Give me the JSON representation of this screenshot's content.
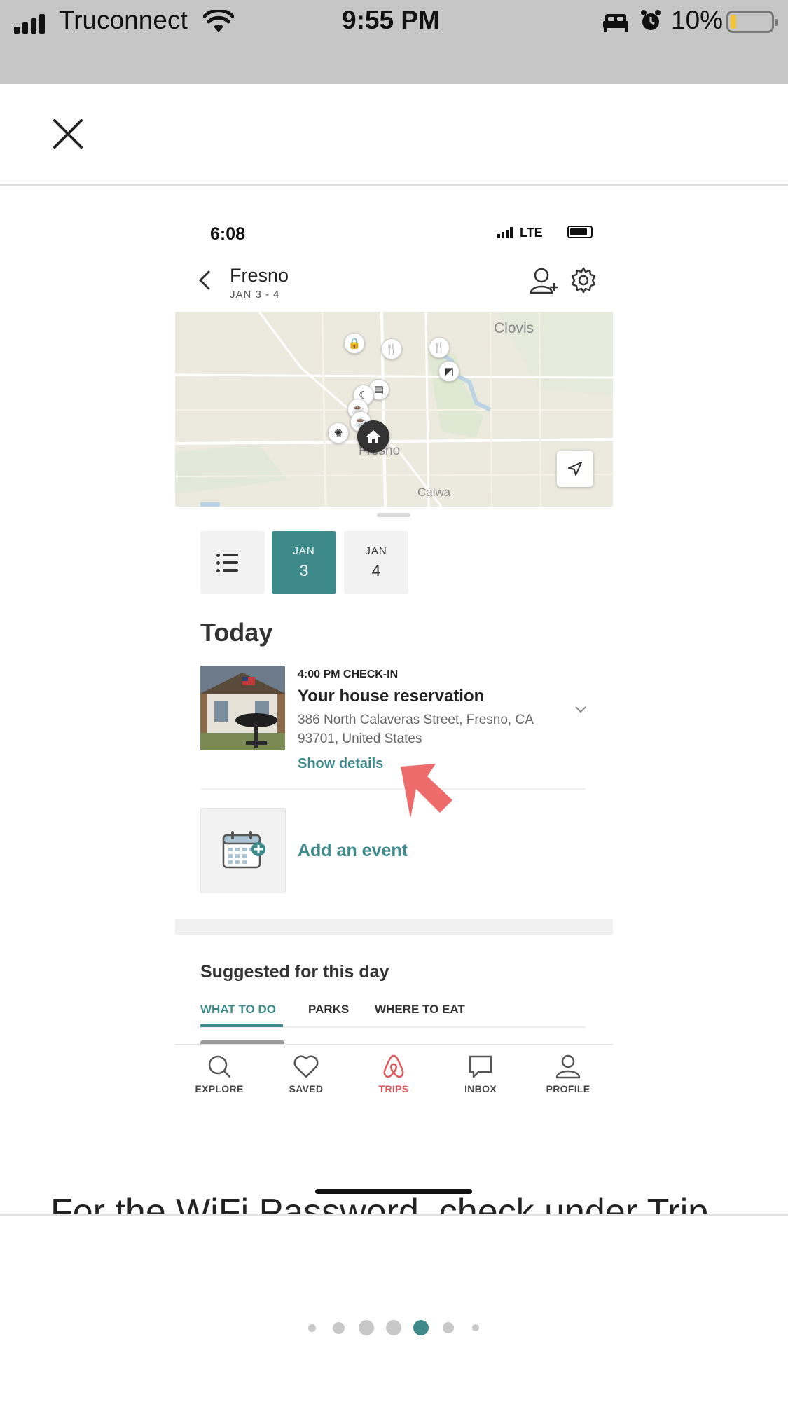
{
  "status_bar": {
    "carrier": "Truconnect",
    "time": "9:55 PM",
    "battery": "10%"
  },
  "inner_screen": {
    "status_time": "6:08",
    "status_network": "LTE",
    "trip": {
      "city": "Fresno",
      "dates": "JAN 3 - 4"
    },
    "map": {
      "labels": [
        "Clovis",
        "Fresno",
        "Calwa"
      ]
    },
    "day_tabs": [
      {
        "month": "JAN",
        "day": "3",
        "active": true
      },
      {
        "month": "JAN",
        "day": "4",
        "active": false
      }
    ],
    "section_title": "Today",
    "reservation": {
      "time": "4:00 PM CHECK-IN",
      "title": "Your house reservation",
      "address_line1": "386 North Calaveras Street, Fresno, CA",
      "address_line2": "93701, United States",
      "link": "Show details"
    },
    "add_event": "Add an event",
    "suggested": {
      "title": "Suggested for this day",
      "tabs": [
        "WHAT TO DO",
        "PARKS",
        "WHERE TO EAT"
      ],
      "active_tab": "WHAT TO DO"
    },
    "tabbar": [
      {
        "label": "EXPLORE",
        "icon": "search-icon"
      },
      {
        "label": "SAVED",
        "icon": "heart-icon"
      },
      {
        "label": "TRIPS",
        "icon": "airbnb-logo-icon",
        "active": true
      },
      {
        "label": "INBOX",
        "icon": "message-icon"
      },
      {
        "label": "PROFILE",
        "icon": "user-icon"
      }
    ]
  },
  "caption": "For the WiFi Password, check under Trip",
  "pagination": {
    "count": 7,
    "active_index": 4
  },
  "colors": {
    "accent": "#3e8a8b",
    "trips_active": "#e0575b",
    "pointer_arrow": "#ee6b6b"
  }
}
